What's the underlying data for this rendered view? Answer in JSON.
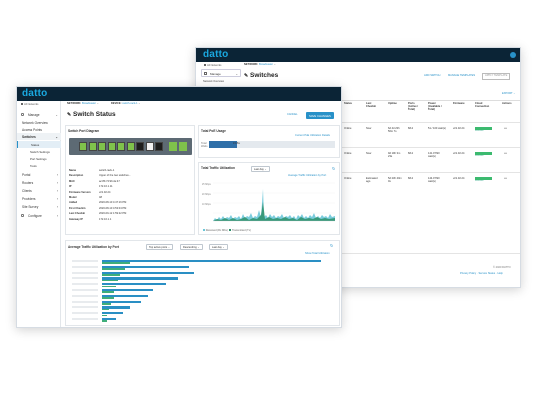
{
  "back": {
    "logo": "datto",
    "all_networks": "All Networks",
    "manage": "Manage",
    "network_overview": "Network Overview",
    "network_label": "NETWORK:",
    "network_value": "Broadcaster",
    "title": "Switches",
    "btn_add": "ADD SWITCH",
    "btn_templates": "MANAGE TEMPLATES",
    "btn_apply": "APPLY TEMPLATE",
    "export": "EXPORT",
    "headers": [
      "Status",
      "Last Checkin",
      "Uptime",
      "Ports (Active / Total)",
      "Power (Available / Total)",
      "Firmware",
      "Cloud Connection",
      "Actions"
    ],
    "rows": [
      {
        "status": "Online",
        "checkin": "Now",
        "uptime": "6d 4d 23h 56m 7s",
        "ports": "8/12",
        "power": "51 / 100 watt(s)",
        "firmware": "v21.02.24",
        "cloud": "cloud online"
      },
      {
        "status": "Online",
        "checkin": "Now",
        "uptime": "9d 19h 3m 23s",
        "ports": "8/12",
        "power": "141.07/90 watt(s)",
        "firmware": "v21.02.24",
        "cloud": "cloud online"
      },
      {
        "status": "Online",
        "checkin": "Estimated ago",
        "uptime": "5d 23h 40m 0s",
        "ports": "8/12",
        "power": "144.07/90 watt(s)",
        "firmware": "v21.02.24",
        "cloud": "cloud online"
      }
    ],
    "copyright": "© 2020 DATTO",
    "footer_links": "Privacy Policy · Service Status · Help"
  },
  "front": {
    "logo": "datto",
    "all_networks": "All Networks",
    "sidebar": [
      {
        "label": "Manage",
        "icon": "grid-icon"
      },
      {
        "label": "Network Overview",
        "icon": ""
      },
      {
        "label": "Access Points",
        "icon": ""
      },
      {
        "label": "Switches",
        "icon": ""
      },
      {
        "label": "Status",
        "icon": ""
      },
      {
        "label": "Switch Settings",
        "icon": ""
      },
      {
        "label": "Port Settings",
        "icon": ""
      },
      {
        "label": "Tools",
        "icon": ""
      },
      {
        "label": "Portal",
        "icon": ""
      },
      {
        "label": "Routers",
        "icon": ""
      },
      {
        "label": "Clients",
        "icon": ""
      },
      {
        "label": "Providers",
        "icon": ""
      },
      {
        "label": "Site Survey",
        "icon": ""
      },
      {
        "label": "Configure",
        "icon": "wrench-icon"
      }
    ],
    "network_label": "NETWORK:",
    "network_value": "Broadcaster",
    "device_label": "DEVICE:",
    "device_value": "switch-rack-1",
    "title": "Switch Status",
    "btn_cancel": "CANCEL",
    "btn_save": "SAVE CHANGES",
    "port_diagram_title": "Switch Port Diagram",
    "details": [
      {
        "k": "Name",
        "v": "switch-rack-1"
      },
      {
        "k": "Description",
        "v": "Upper of the two switches..."
      },
      {
        "k": "MAC",
        "v": "ac:8b:74:9b:de:47"
      },
      {
        "k": "IP",
        "v": "172.16.1.11"
      },
      {
        "k": "Firmware Version",
        "v": "v21.02.24"
      },
      {
        "k": "Model",
        "v": "48"
      },
      {
        "k": "Added",
        "v": "2020-08-10 4:47:16 PM"
      },
      {
        "k": "First Checkin",
        "v": "2020-08-10 4:53:04 PM"
      },
      {
        "k": "Last Checkin",
        "v": "2020-09-12 1:59:22 PM"
      },
      {
        "k": "Gateway IP",
        "v": "172.16.1.1"
      }
    ],
    "poe_title": "Total PoE Usage",
    "poe_link": "Current PoE Utilization Details",
    "poe_label": "Total Watts",
    "poe_value": "15.8w",
    "poe_fraction": 0.22,
    "traffic_title": "Total Traffic Utilization",
    "traffic_range": "Last day",
    "traffic_link": "Average Traffic Utilization by Port",
    "traffic_legend": [
      "Received (Rx Mbs)",
      "Transmitted (Tx)"
    ],
    "avg_title": "Average Traffic Utilization by Port",
    "avg_sel1": "Top active ports",
    "avg_sel2": "Descending",
    "avg_sel3": "Last day",
    "avg_link": "Show Total Utilization"
  }
}
